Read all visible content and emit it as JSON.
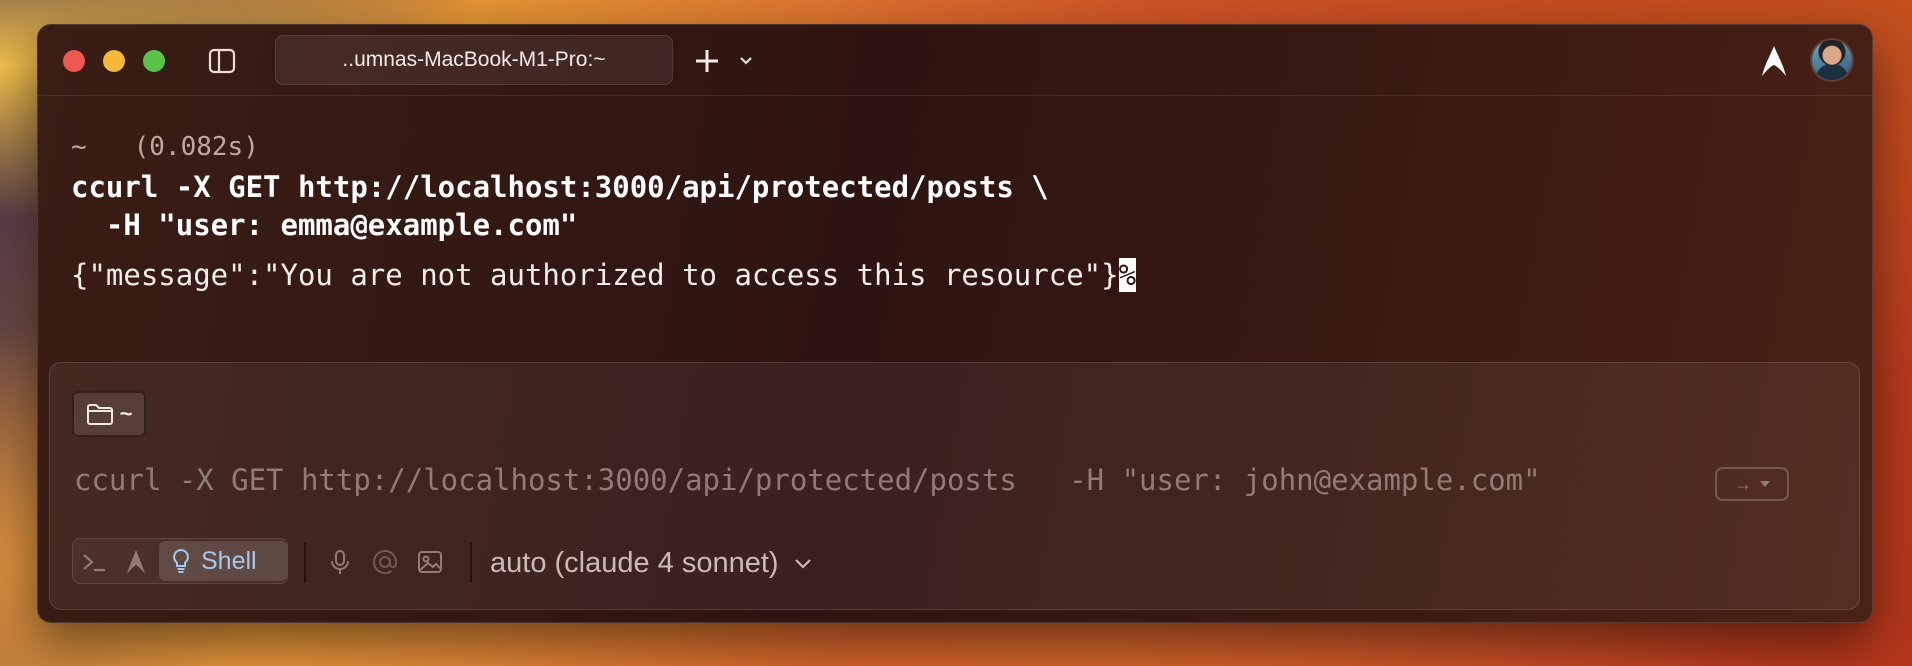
{
  "window": {
    "tab_title": "..umnas-MacBook-M1-Pro:~"
  },
  "icons": {
    "sidebar": "sidebar-toggle-icon",
    "new_tab": "plus-icon",
    "tab_menu": "chevron-down-icon",
    "app_logo": "warp-logo-icon",
    "avatar": "user-avatar",
    "folder": "folder-icon",
    "terminal": "terminal-prompt-icon",
    "agent": "agent-icon",
    "shell": "lightbulb-icon",
    "mic": "microphone-icon",
    "at": "at-mention-icon",
    "image": "image-attach-icon"
  },
  "output": {
    "prompt_dir": "~",
    "duration": "(0.082s)",
    "command_line1": "ccurl -X GET http://localhost:3000/api/protected/posts \\",
    "command_line2": "  -H \"user: emma@example.com\"",
    "response": "{\"message\":\"You are not authorized to access this resource\"}",
    "eol_mark": "%"
  },
  "input": {
    "dir_chip": "~",
    "suggestion": "ccurl -X GET http://localhost:3000/api/protected/posts   -H \"user: john@example.com\"",
    "accept_arrow": "→",
    "mode_shell_label": "Shell",
    "model_label": "auto (claude 4 sonnet)"
  },
  "colors": {
    "accent_shell": "#a9c6ee",
    "close": "#ee5a52",
    "minimize": "#f5b83a",
    "maximize": "#5cc34a"
  }
}
